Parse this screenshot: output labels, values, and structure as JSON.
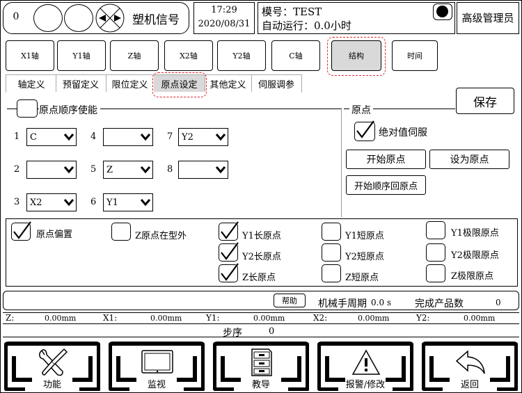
{
  "header": {
    "counter": "0",
    "signal_label": "塑机信号",
    "time": "17:29",
    "date": "2020/08/31",
    "mold_label": "模号：TEST",
    "auto_run_label": "自动运行：0.0小时",
    "user_level": "高级管理员"
  },
  "category_buttons": [
    "X1轴",
    "Y1轴",
    "Z轴",
    "X2轴",
    "Y2轴",
    "C轴",
    "结构",
    "时间"
  ],
  "active_category": "结构",
  "tabs": [
    "轴定义",
    "预留定义",
    "限位定义",
    "原点设定",
    "其他定义",
    "伺服调参"
  ],
  "active_tab": "原点设定",
  "save_label": "保存",
  "origin_order": {
    "enable_label": "原点顺序使能",
    "enabled": false,
    "slots": [
      {
        "num": "1",
        "value": "C"
      },
      {
        "num": "2",
        "value": ""
      },
      {
        "num": "3",
        "value": "X2"
      },
      {
        "num": "4",
        "value": ""
      },
      {
        "num": "5",
        "value": "Z"
      },
      {
        "num": "6",
        "value": "Y1"
      },
      {
        "num": "7",
        "value": "Y2"
      },
      {
        "num": "8",
        "value": ""
      }
    ]
  },
  "origin": {
    "title": "原点",
    "absolute_servo_label": "绝对值伺服",
    "absolute_servo_checked": true,
    "start_origin": "开始原点",
    "set_as_origin": "设为原点",
    "start_sequence_origin": "开始顺序回原点"
  },
  "options": {
    "origin_offset": {
      "label": "原点偏置",
      "checked": true
    },
    "z_origin_outside": {
      "label": "Z原点在型外",
      "checked": false
    },
    "y1_long": {
      "label": "Y1长原点",
      "checked": true
    },
    "y2_long": {
      "label": "Y2长原点",
      "checked": true
    },
    "z_long": {
      "label": "Z长原点",
      "checked": true
    },
    "y1_short": {
      "label": "Y1短原点",
      "checked": false
    },
    "y2_short": {
      "label": "Y2短原点",
      "checked": false
    },
    "z_short": {
      "label": "Z短原点",
      "checked": false
    },
    "y1_limit": {
      "label": "Y1极限原点",
      "checked": false
    },
    "y2_limit": {
      "label": "Y2极限原点",
      "checked": false
    },
    "z_limit": {
      "label": "Z极限原点",
      "checked": false
    }
  },
  "status": {
    "help_label": "帮助",
    "cycle_label": "机械手周期",
    "cycle_value": "0.0 s",
    "products_label": "完成产品数",
    "products_value": "0"
  },
  "positions": [
    {
      "axis": "Z:",
      "value": "0.00mm"
    },
    {
      "axis": "X1:",
      "value": "0.00mm"
    },
    {
      "axis": "Y1:",
      "value": "0.00mm"
    },
    {
      "axis": "X2:",
      "value": "0.00mm"
    },
    {
      "axis": "Y2:",
      "value": "0.00mm"
    }
  ],
  "step": {
    "label": "步序",
    "value": "0"
  },
  "nav": [
    {
      "label": "功能",
      "icon": "tools-icon"
    },
    {
      "label": "监视",
      "icon": "monitor-icon"
    },
    {
      "label": "教导",
      "icon": "cabinet-icon"
    },
    {
      "label": "报警/修改",
      "icon": "warning-icon"
    },
    {
      "label": "返回",
      "icon": "back-arrow-icon"
    }
  ]
}
